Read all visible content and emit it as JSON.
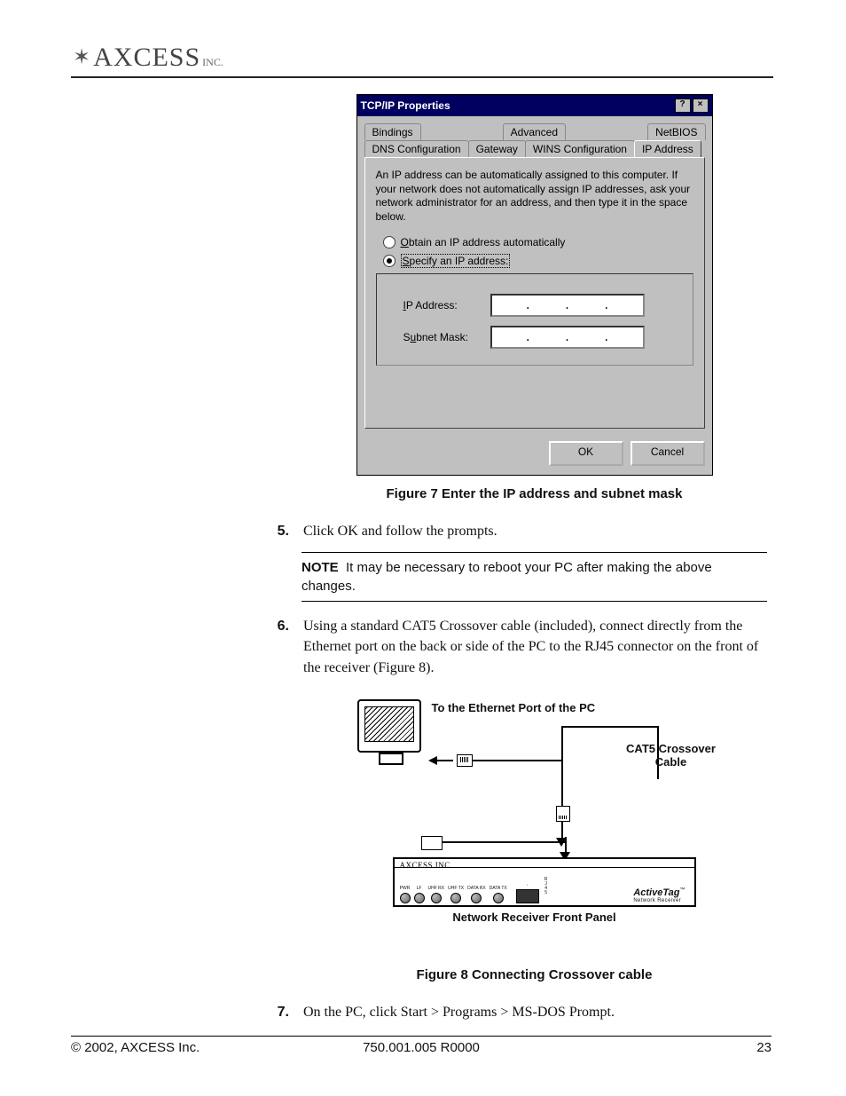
{
  "header": {
    "logo_text": "AXCESS",
    "logo_suffix": "INC."
  },
  "dialog": {
    "title": "TCP/IP Properties",
    "help_btn": "?",
    "close_btn": "×",
    "tabs_row1": [
      "Bindings",
      "Advanced",
      "NetBIOS"
    ],
    "tabs_row2": [
      "DNS Configuration",
      "Gateway",
      "WINS Configuration",
      "IP Address"
    ],
    "active_tab": "IP Address",
    "description": "An IP address can be automatically assigned to this computer. If your network does not automatically assign IP addresses, ask your network administrator for an address, and then type it in the space below.",
    "radio_obtain": "Obtain an IP address automatically",
    "radio_specify": "Specify an IP address:",
    "ip_label": "IP Address:",
    "subnet_label": "Subnet Mask:",
    "ip_value_dots": ". . .",
    "subnet_value_dots": ". . .",
    "ok_btn": "OK",
    "cancel_btn": "Cancel"
  },
  "figure7": {
    "caption": "Figure 7  Enter the IP address and subnet mask"
  },
  "steps": {
    "s5_num": "5.",
    "s5_text": "Click OK and follow the prompts.",
    "s6_num": "6.",
    "s6_text": "Using a standard CAT5 Crossover cable (included), connect directly from the Ethernet port on the back or side of the PC to the RJ45 connector on the front of the receiver (Figure 8).",
    "s7_num": "7.",
    "s7_text": "On the PC, click Start > Programs > MS-DOS Prompt."
  },
  "note": {
    "label": "NOTE",
    "text": "It may be necessary to reboot your PC after making the above changes."
  },
  "figure8": {
    "eth_label": "To the Ethernet Port of the PC",
    "cat5_label": "CAT5 Crossover Cable",
    "receiver_brand": "AXCESS INC.",
    "led_labels": [
      "PWR",
      "LF",
      "UHF RX",
      "UHF TX",
      "DATA RX",
      "DATA TX"
    ],
    "rj45_label": "R J 4 5",
    "dot_label": "·",
    "product_name": "ActiveTag",
    "tm": "™",
    "product_sub": "Network Receiver",
    "front_panel": "Network Receiver Front Panel",
    "caption": "Figure 8  Connecting Crossover cable"
  },
  "footer": {
    "left": "© 2002, AXCESS Inc.",
    "mid": "750.001.005 R0000",
    "right": "23"
  }
}
